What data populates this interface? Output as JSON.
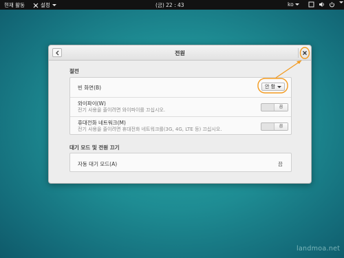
{
  "topbar": {
    "activities": "현재 활동",
    "app_menu": "설정",
    "clock": "(금) 22 : 43",
    "language": "ko"
  },
  "dialog": {
    "title": "전원",
    "sections": {
      "power_saving": {
        "label": "절전",
        "blank_screen": {
          "title": "빈 화면(B)",
          "value": "안 함"
        },
        "wifi": {
          "title": "와이파이(W)",
          "subtitle": "전기 사용을 줄이려면 와이파이를 끄십시오.",
          "state": "끔"
        },
        "mobile": {
          "title": "휴대전화 네트워크(M)",
          "subtitle": "전기 사용을 줄이려면 휴대전화 네트워크를(3G, 4G, LTE 등) 끄십시오.",
          "state": "끔"
        }
      },
      "suspend": {
        "label": "대기 모드 및 전원 끄기",
        "auto_suspend": {
          "title": "자동 대기 모드(A)",
          "value": "끔"
        }
      }
    }
  },
  "colors": {
    "annotation": "#f39a1e",
    "topbar": "#121212",
    "desktop": "#1e8c93"
  },
  "icons": [
    "back-arrow-icon",
    "close-icon",
    "dropdown-arrow-icon",
    "settings-icon",
    "network-icon",
    "volume-icon",
    "power-icon"
  ],
  "watermark": "landmoa.net"
}
